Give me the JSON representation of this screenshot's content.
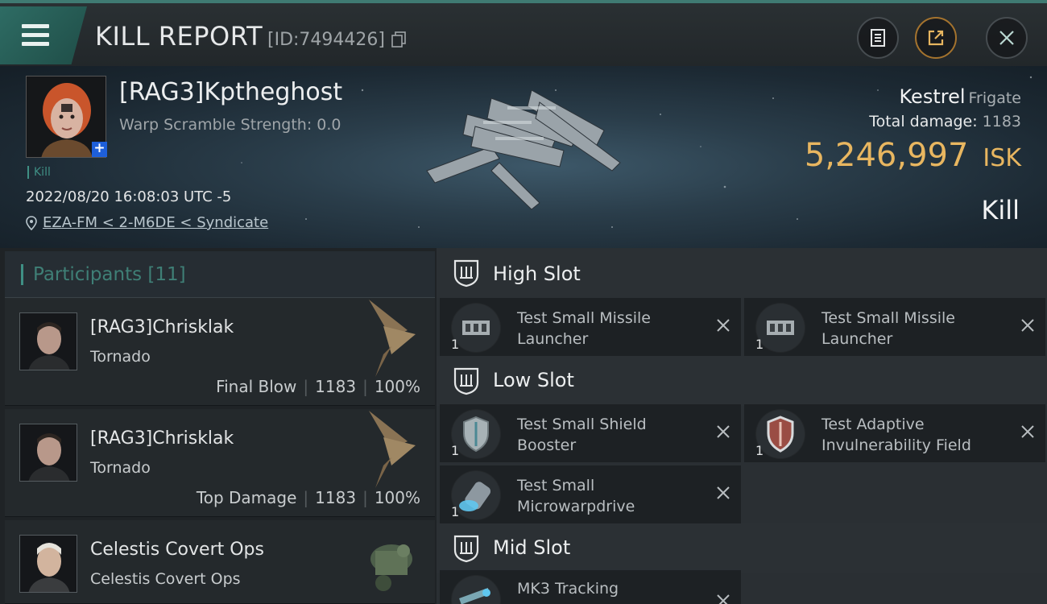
{
  "header": {
    "title": "KILL REPORT",
    "id_text": "[ID:7494426]"
  },
  "victim": {
    "name": "[RAG3]Kptheghost",
    "warp_scramble": "Warp Scramble Strength: 0.0",
    "tag": "Kill",
    "datetime": "2022/08/20 16:08:03 UTC -5",
    "location": "EZA-FM < 2-M6DE < Syndicate",
    "ship_name": "Kestrel",
    "ship_class": "Frigate",
    "total_damage_label": "Total damage:",
    "total_damage_value": "1183",
    "isk_value": "5,246,997",
    "isk_unit": "ISK",
    "outcome": "Kill",
    "plus": "+"
  },
  "participants": {
    "title": "Participants",
    "count": "[11]",
    "rows": [
      {
        "name": "[RAG3]Chrisklak",
        "ship": "Tornado",
        "role": "Final Blow",
        "damage": "1183",
        "percent": "100%"
      },
      {
        "name": "[RAG3]Chrisklak",
        "ship": "Tornado",
        "role": "Top Damage",
        "damage": "1183",
        "percent": "100%"
      },
      {
        "name": "Celestis Covert Ops",
        "ship": "Celestis Covert Ops"
      }
    ]
  },
  "fitting": {
    "high_slot": {
      "label": "High Slot",
      "items": [
        {
          "name": "Test Small Missile Launcher",
          "qty": "1"
        },
        {
          "name": "Test Small Missile Launcher",
          "qty": "1"
        }
      ]
    },
    "low_slot": {
      "label": "Low Slot",
      "items": [
        {
          "name": "Test Small Shield Booster",
          "qty": "1"
        },
        {
          "name": "Test Adaptive Invulnerability Field",
          "qty": "1"
        },
        {
          "name": "Test Small Microwarpdrive",
          "qty": "1"
        }
      ]
    },
    "mid_slot": {
      "label": "Mid Slot",
      "items": [
        {
          "name": "MK3 Tracking"
        }
      ]
    }
  },
  "colors": {
    "accent_teal": "#3f8f84",
    "isk_gold": "#e8b660",
    "menu_green": "#2e6c64"
  }
}
